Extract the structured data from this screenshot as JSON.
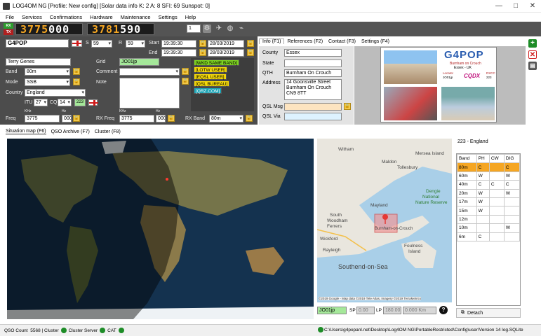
{
  "app": {
    "title": "LOG4OM NG [Profile: New config] [Solar data info K: 2 A: 8 SFI: 69 Sunspot: 0]"
  },
  "window": {
    "minimize": "—",
    "maximize": "□",
    "close": "✕"
  },
  "menu": [
    "File",
    "Services",
    "Confirmations",
    "Hardware",
    "Maintenance",
    "Settings",
    "Help"
  ],
  "radio": {
    "rx_label": "RX",
    "tx_label": "TX",
    "rx_freq_int": "3775",
    "rx_freq_dec": "000",
    "tx_freq_int": "3781",
    "tx_freq_dec": "590",
    "slot": "1"
  },
  "qso": {
    "callsign": "G4POP",
    "s_label": "S",
    "s_value": "59",
    "r_label": "R",
    "r_value": "59",
    "start_label": "Start",
    "start_time": "19:39:30",
    "start_date": "28/03/2019",
    "end_label": "End",
    "end_time": "19:39:30",
    "end_date": "28/03/2019",
    "name": "Terry Genes",
    "grid_label": "Grid",
    "grid": "JO01jp",
    "band_label": "Band",
    "band": "80m",
    "comment_label": "Comment",
    "mode_label": "Mode",
    "mode": "SSB",
    "note_label": "Note",
    "country_label": "Country",
    "country": "England",
    "itu_label": "ITU",
    "itu": "27",
    "cq_label": "CQ",
    "cq": "14",
    "dxcc": "223",
    "freq_label": "Freq",
    "khz": "KHz",
    "hz": "Hz",
    "freq": "3775",
    "freq_hz": "000",
    "rxfreq_label": "RX Freq",
    "rx_freq": "3775",
    "rx_freq_hz": "000",
    "rxband_label": "RX Band",
    "rx_band": "80m"
  },
  "tags": [
    {
      "text": "[WKD SAME BAND]",
      "bg": "#7ed321",
      "fg": "#000"
    },
    {
      "text": "[LOTW USER]",
      "bg": "#f5d90a",
      "fg": "#000"
    },
    {
      "text": "[EQSL USER]",
      "bg": "#f5d90a",
      "fg": "#000"
    },
    {
      "text": "[QSL BUREAU]",
      "bg": "#f5d90a",
      "fg": "#000"
    },
    {
      "text": "[QRZ.COM]",
      "bg": "#1aa3b5",
      "fg": "#fff"
    }
  ],
  "info_tabs": [
    "Info (F1)",
    "References (F2)",
    "Contact (F3)",
    "Settings (F4)"
  ],
  "info": {
    "county_label": "County",
    "county": "Essex",
    "state_label": "State",
    "state": "",
    "qth_label": "QTH",
    "qth": "Burnham On Crouch",
    "address_label": "Address",
    "address": [
      "14 Goonsville Street",
      "Burnham On Crouch",
      "CN9 8TT"
    ],
    "qslmsg_label": "QSL Msg",
    "qslvia_label": "QSL Via"
  },
  "card": {
    "callsign": "G4POP",
    "line1": "Burnham on Crouch",
    "line2": "Essex - UK",
    "locator": "Locator",
    "loc_val": "JO01jp",
    "cq": "CQ",
    "cqv": "14",
    "itu": "ITU",
    "ituv": "27",
    "dxcc": "DXCC",
    "dxccv": "223"
  },
  "lower_tabs": [
    "Situation map (F6)",
    "QSO Archive (F7)",
    "Cluster (F8)"
  ],
  "zoom_map": {
    "places": [
      "Witham",
      "Mersea Island",
      "Maldon",
      "Tollesbury",
      "Dengie",
      "National",
      "Nature Reserve",
      "Mayland",
      "South",
      "Woodham",
      "Ferrers",
      "Burnham-on-Crouch",
      "Wickford",
      "Foulness",
      "Island",
      "Rayleigh",
      "Southend-on-Sea"
    ],
    "copyright": "©2019 Google - Map data ©2019 Tele Atlas, Imagery ©2019 TerraMetrics"
  },
  "bottom": {
    "grid": "JO01jp",
    "sp_label": "SP",
    "sp_value": "0.00",
    "lp_label": "LP",
    "lp_value": "180.00",
    "distance": "0.000 Km",
    "help": "?"
  },
  "band_panel": {
    "title": "223 - England",
    "headers": [
      "Band",
      "PH",
      "CW",
      "DIG"
    ],
    "rows": [
      [
        "80m",
        "C",
        "",
        "C"
      ],
      [
        "60m",
        "W",
        "",
        "W"
      ],
      [
        "40m",
        "C",
        "C",
        "C"
      ],
      [
        "20m",
        "W",
        "",
        "W"
      ],
      [
        "17m",
        "W",
        "",
        ""
      ],
      [
        "15m",
        "W",
        "",
        ""
      ],
      [
        "12m",
        "",
        "",
        ""
      ],
      [
        "10m",
        "",
        "",
        "W"
      ],
      [
        "6m",
        "C",
        "",
        ""
      ]
    ],
    "detach": "Detach"
  },
  "status": {
    "qso_count_label": "QSO Count",
    "qso_count": "5568",
    "cluster": "Cluster",
    "cluster_server": "Cluster Server",
    "cat": "CAT",
    "path": "C:\\Users\\g4popanl.net\\Desktop\\Log4OM NG\\PortableRestricted\\Config\\user\\Version 14 log.SQLite"
  },
  "colors": {
    "panel": "#4c4c4c",
    "accent": "#f2c94c",
    "highlight": "#f5a623",
    "grid_bg": "#a5e89a"
  }
}
